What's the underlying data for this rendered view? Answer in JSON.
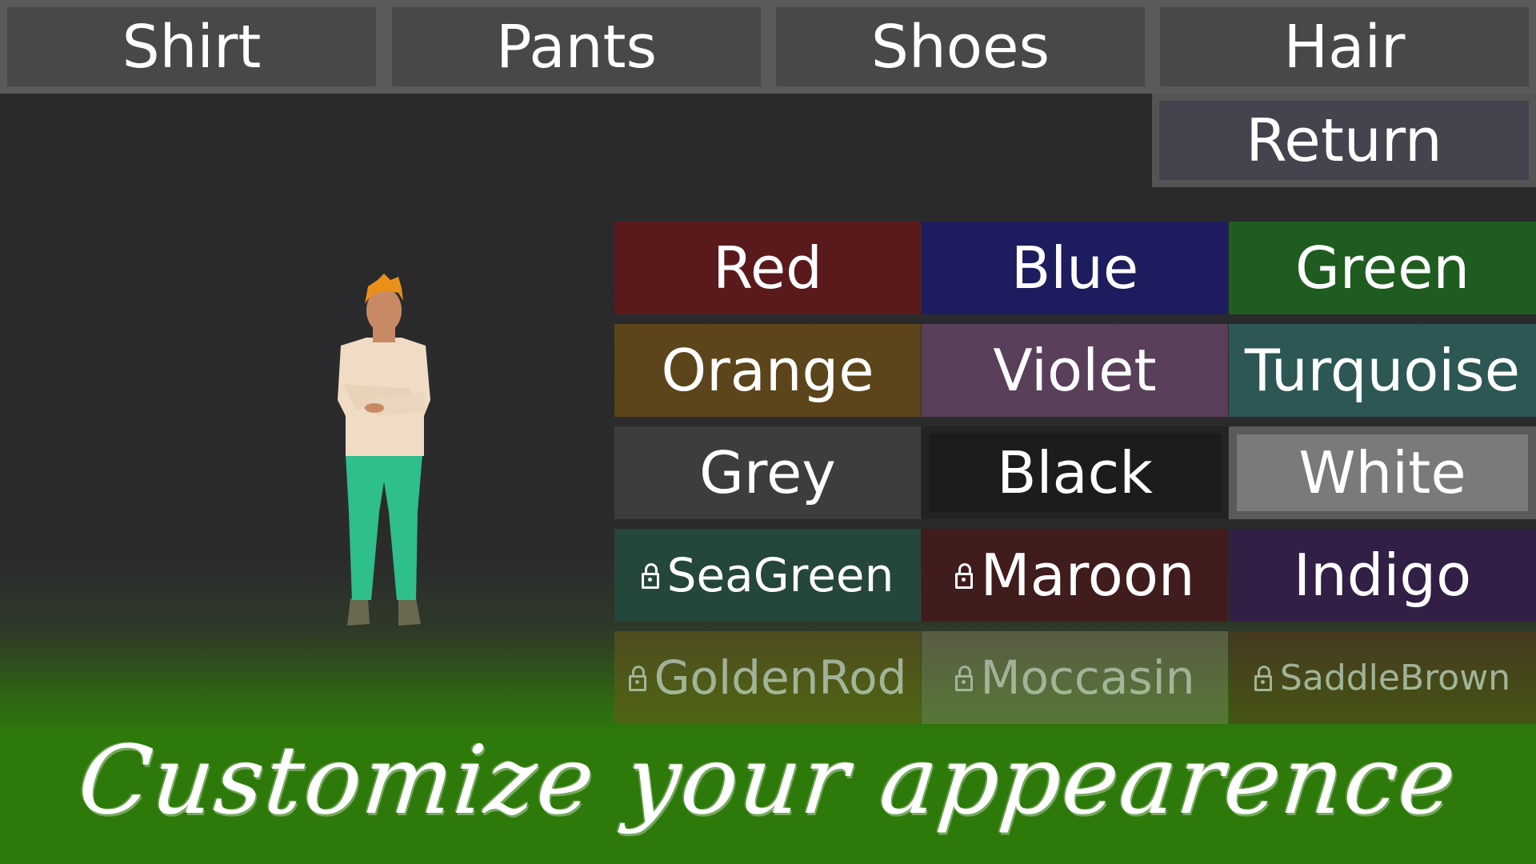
{
  "tabs": [
    {
      "label": "Shirt"
    },
    {
      "label": "Pants"
    },
    {
      "label": "Shoes"
    },
    {
      "label": "Hair"
    }
  ],
  "return_label": "Return",
  "colors": [
    {
      "label": "Red",
      "bg": "#5a1a1c",
      "locked": false
    },
    {
      "label": "Blue",
      "bg": "#1d1c5e",
      "locked": false
    },
    {
      "label": "Green",
      "bg": "#1f5c20",
      "locked": false
    },
    {
      "label": "Orange",
      "bg": "#5c451a",
      "locked": false
    },
    {
      "label": "Violet",
      "bg": "#5a3f5a",
      "locked": false
    },
    {
      "label": "Turquoise",
      "bg": "#2c5755",
      "locked": false
    },
    {
      "label": "Grey",
      "bg": "#3d3d3f",
      "locked": false
    },
    {
      "label": "Black",
      "bg": "#1c1c1c",
      "locked": false
    },
    {
      "label": "White",
      "bg": "#7a7a7a",
      "locked": false,
      "selected": true
    },
    {
      "label": "SeaGreen",
      "bg": "#25463a",
      "locked": true
    },
    {
      "label": "Maroon",
      "bg": "#401c1c",
      "locked": true
    },
    {
      "label": "Indigo",
      "bg": "#311f45",
      "locked": false
    },
    {
      "label": "GoldenRod",
      "bg": "#6a5a1a",
      "locked": true
    },
    {
      "label": "Moccasin",
      "bg": "#7a7a5a",
      "locked": true
    },
    {
      "label": "SaddleBrown",
      "bg": "#5a3a1a",
      "locked": true
    }
  ],
  "character": {
    "hair_color": "#e8901a",
    "skin_color": "#c88a64",
    "shirt_color": "#f0dcc4",
    "pants_color": "#2fbf8a",
    "shoes_color": "#6a6a50"
  },
  "banner_text": "Customize your appearence"
}
